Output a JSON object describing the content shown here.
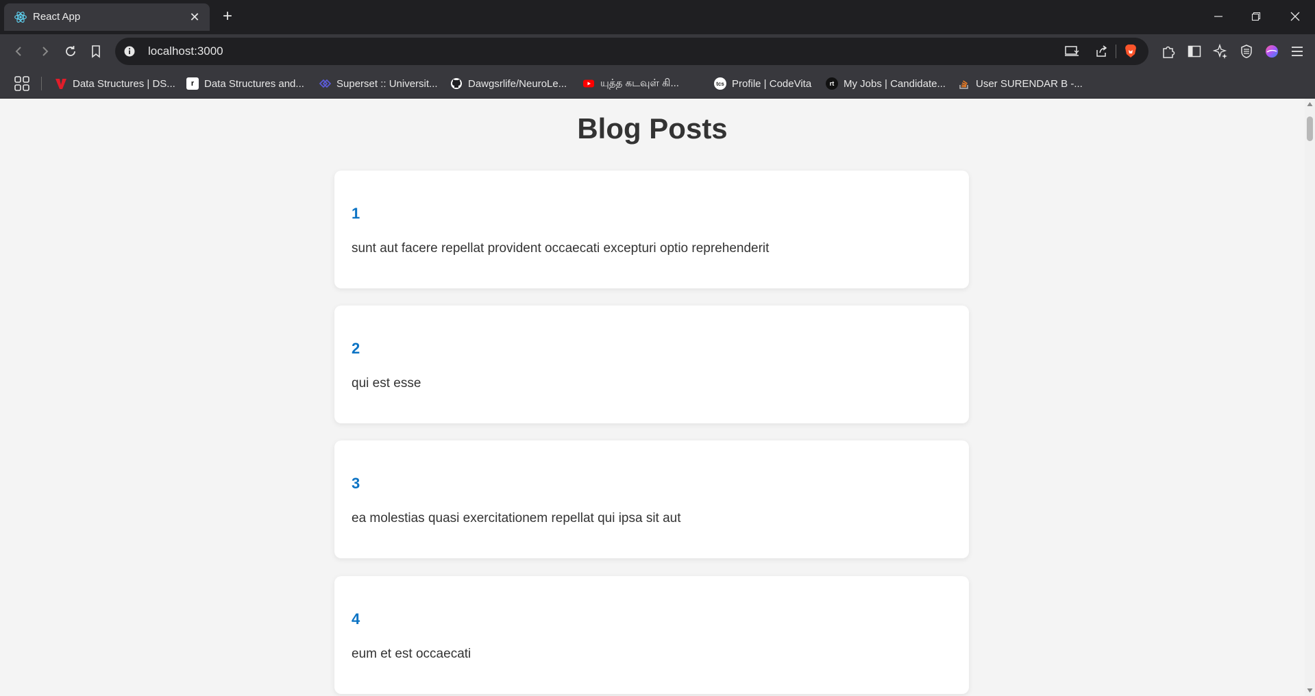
{
  "browser": {
    "tab_title": "React App",
    "url": "localhost:3000",
    "new_tab_symbol": "+",
    "close_symbol": "✕",
    "bookmarks": [
      {
        "label": "Data Structures | DS...",
        "icon": "red-v-icon",
        "color": "#e11d2a"
      },
      {
        "label": "Data Structures and...",
        "icon": "r-logo-icon",
        "color": "#ffffff"
      },
      {
        "label": "Superset :: Universit...",
        "icon": "superset-icon",
        "color": "#5b5bd6"
      },
      {
        "label": "Dawgsrlife/NeuroLe...",
        "icon": "github-icon",
        "color": "#ffffff"
      },
      {
        "label": "யுத்த கடவுள் கி...",
        "icon": "youtube-icon",
        "color": "#ff0000"
      },
      {
        "label": "Profile | CodeVita",
        "icon": "tcs-icon",
        "color": "#ffffff"
      },
      {
        "label": "My Jobs | Candidate...",
        "icon": "rt-icon",
        "color": "#111111"
      },
      {
        "label": "User SURENDAR B -...",
        "icon": "stackoverflow-icon",
        "color": "#f48024"
      }
    ]
  },
  "page": {
    "title": "Blog Posts",
    "posts": [
      {
        "id": "1",
        "title": "sunt aut facere repellat provident occaecati excepturi optio reprehenderit"
      },
      {
        "id": "2",
        "title": "qui est esse"
      },
      {
        "id": "3",
        "title": "ea molestias quasi exercitationem repellat qui ipsa sit aut"
      },
      {
        "id": "4",
        "title": "eum et est occaecati"
      }
    ]
  },
  "colors": {
    "accent": "#0b73c4",
    "page_bg": "#f4f4f4",
    "card_bg": "#ffffff",
    "text": "#333333"
  }
}
